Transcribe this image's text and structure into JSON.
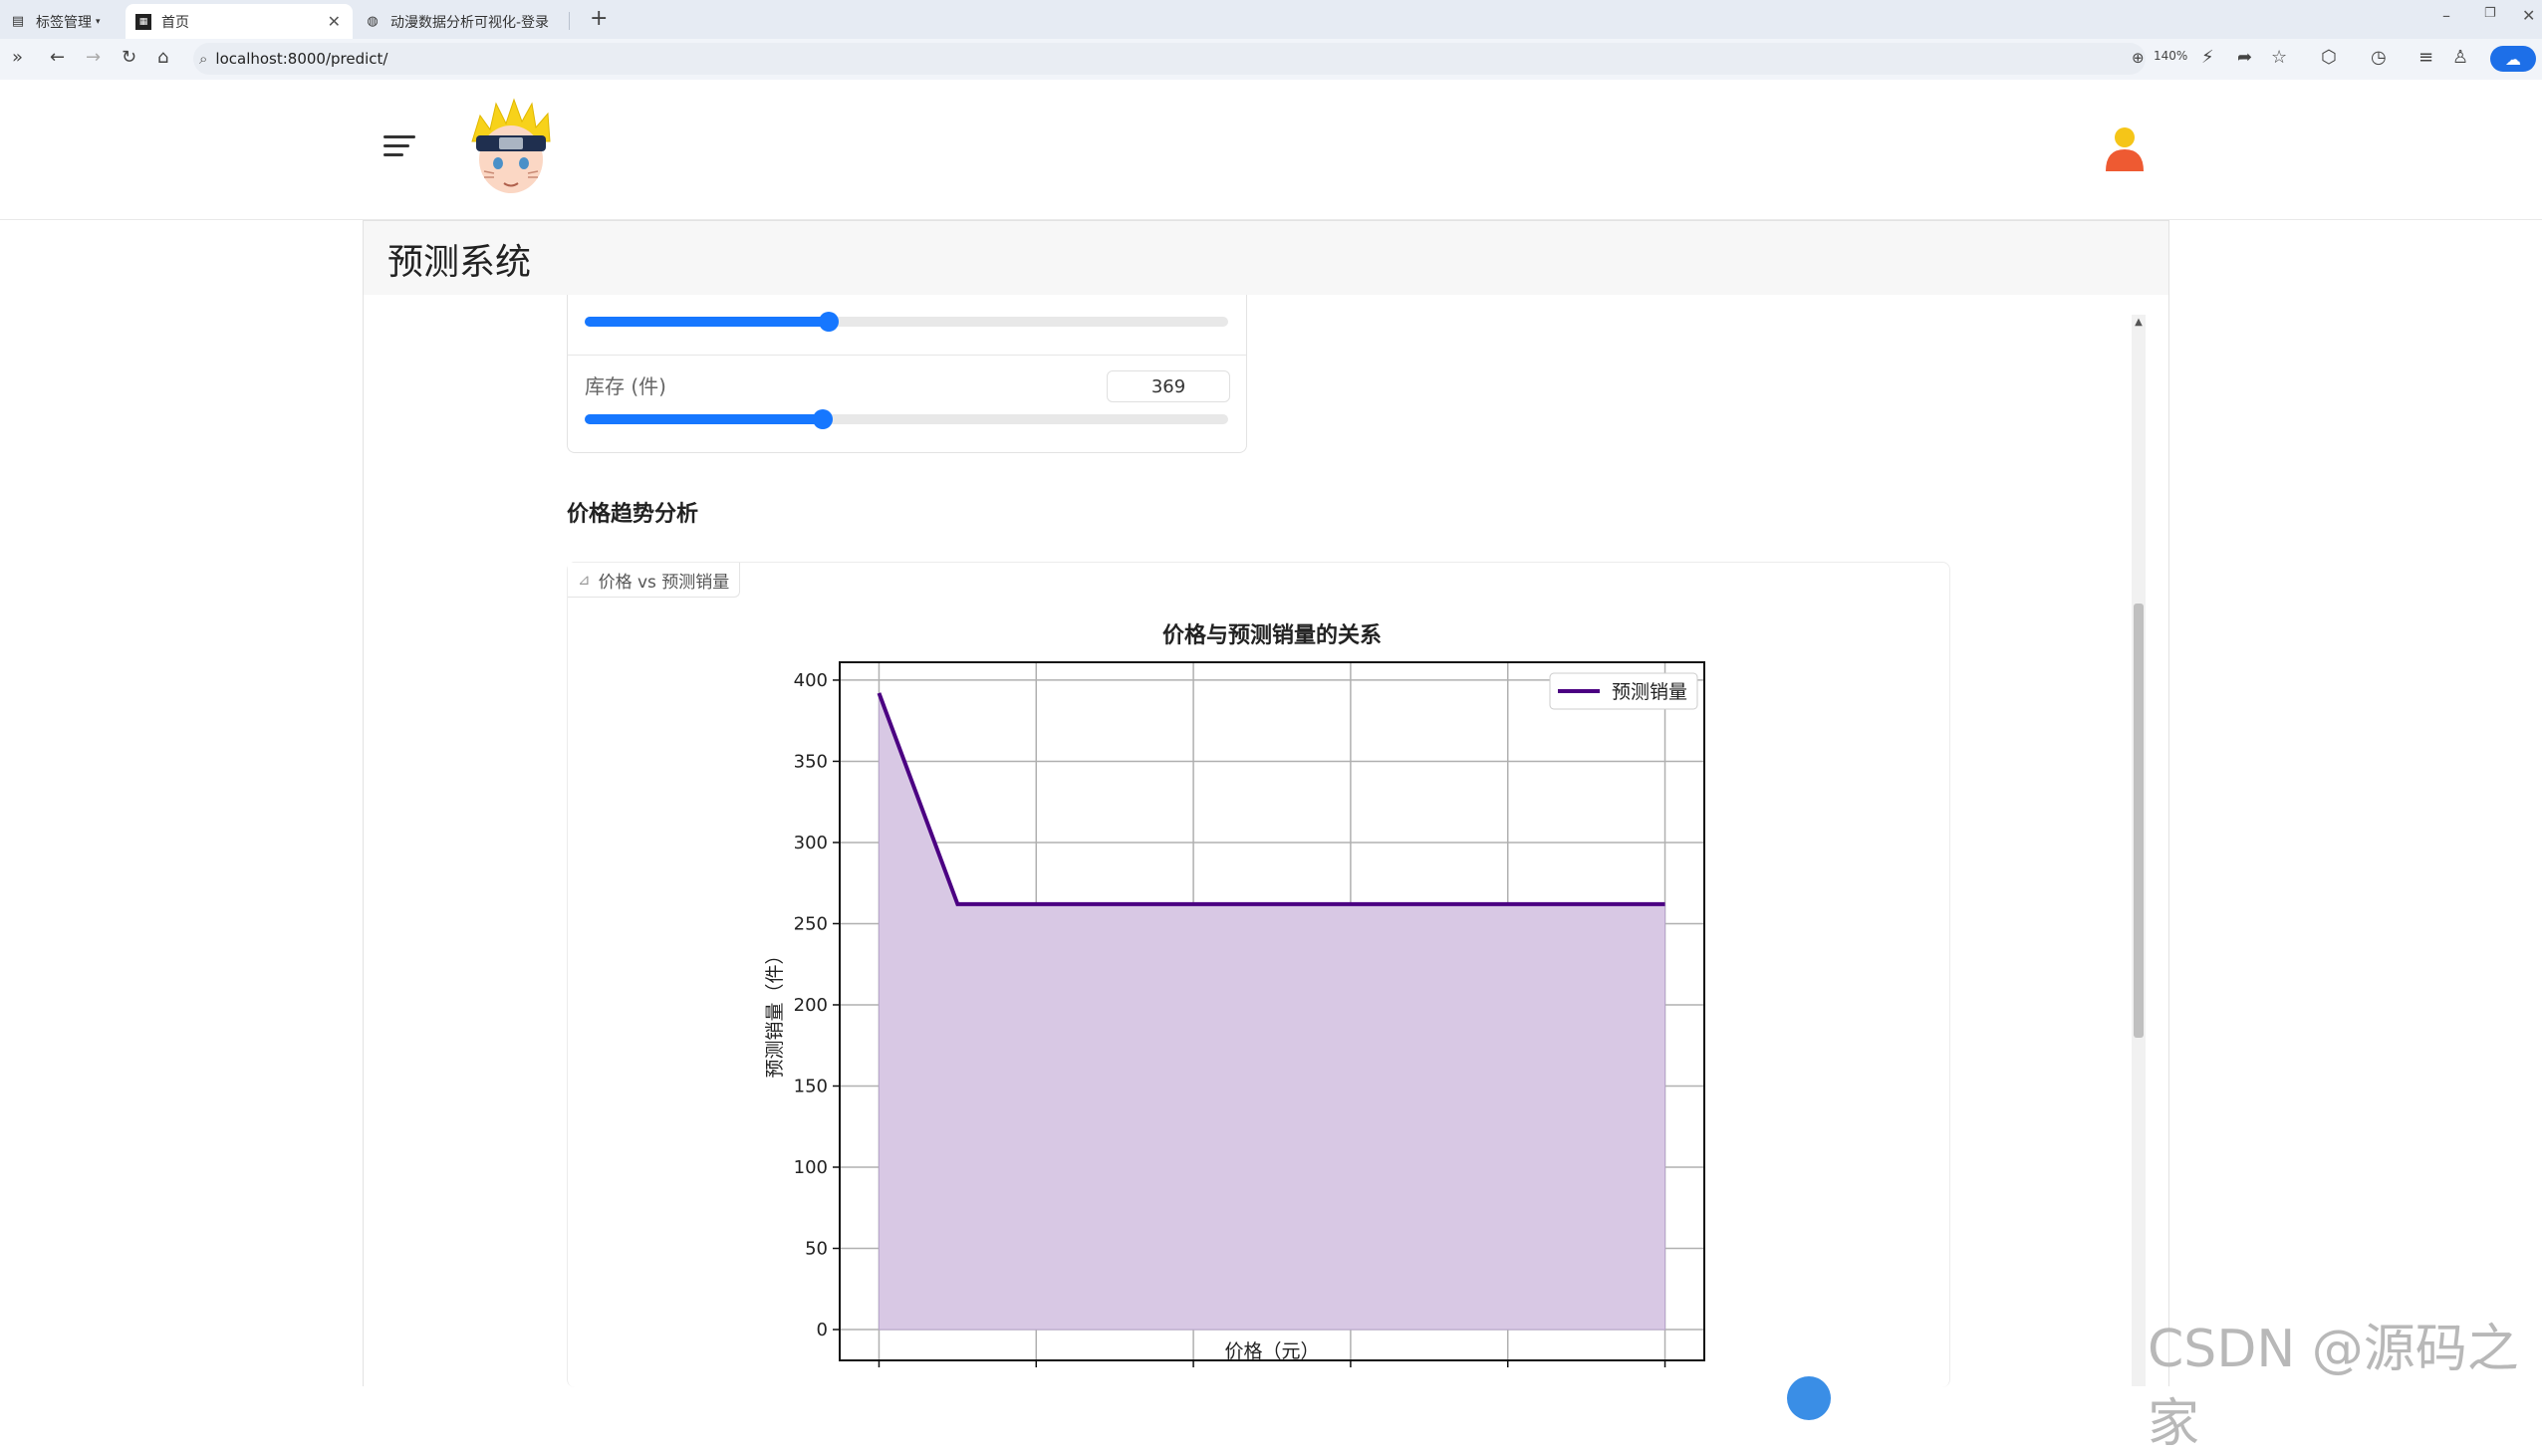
{
  "browser": {
    "tabs": [
      {
        "label": "标签管理"
      },
      {
        "label": "首页"
      },
      {
        "label": "动漫数据分析可视化-登录"
      }
    ],
    "url": "localhost:8000/predict/",
    "zoom": "140%"
  },
  "panel": {
    "title": "预测系统"
  },
  "controls": {
    "slider1_fraction": 0.38,
    "stock_label": "库存 (件)",
    "stock_value": "369",
    "stock_fraction": 0.37
  },
  "section": {
    "title": "价格趋势分析"
  },
  "chart_tab": {
    "label": "价格 vs 预测销量"
  },
  "chart_data": {
    "type": "area",
    "title": "价格与预测销量的关系",
    "xlabel": "价格（元）",
    "ylabel": "预测销量（件）",
    "x": [
      0,
      50,
      500
    ],
    "series": [
      {
        "name": "预测销量",
        "values": [
          392,
          262,
          262
        ]
      }
    ],
    "xlim": [
      -25,
      525
    ],
    "ylim": [
      -19,
      411
    ],
    "xticks": [
      0,
      100,
      200,
      300,
      400,
      500
    ],
    "yticks": [
      0,
      50,
      100,
      150,
      200,
      250,
      300,
      350,
      400
    ],
    "grid": true,
    "legend": "top-right",
    "line_color": "#4b0082",
    "fill_color": "#d8c8e4"
  },
  "watermark": "CSDN @源码之家"
}
